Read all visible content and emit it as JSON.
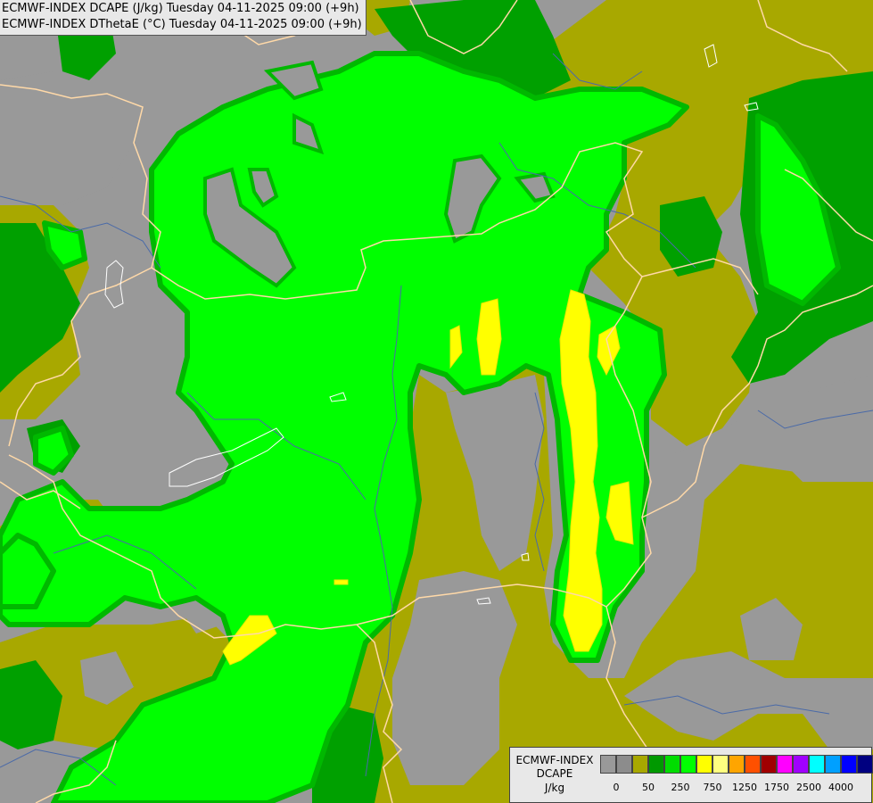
{
  "titles": {
    "line1": "ECMWF-INDEX DCAPE (J/kg) Tuesday 04-11-2025 09:00 (+9h)",
    "line2": "ECMWF-INDEX DThetaE (°C) Tuesday 04-11-2025 09:00 (+9h)"
  },
  "legend": {
    "line1": "ECMWF-INDEX",
    "line2": "DCAPE",
    "line3": "J/kg",
    "colors": [
      "#999999",
      "#8c8c8c",
      "#a8a800",
      "#009900",
      "#00dd00",
      "#00ff00",
      "#ffff00",
      "#ffff80",
      "#ffa500",
      "#ff5000",
      "#a00000",
      "#ff00ff",
      "#a000ff",
      "#00ffff",
      "#00a0ff",
      "#0000ff",
      "#000080"
    ],
    "ticks": [
      "0",
      "50",
      "250",
      "750",
      "1250",
      "1750",
      "2500",
      "4000"
    ]
  },
  "colors": {
    "gray": "#999999",
    "olive": "#a8a800",
    "dark_green": "#00a000",
    "mid_green": "#00cc00",
    "bright_green": "#00ff00",
    "yellow": "#ffff00",
    "border": "#ffd9a8",
    "river": "#4a6aa8",
    "lake": "#ffffff"
  }
}
